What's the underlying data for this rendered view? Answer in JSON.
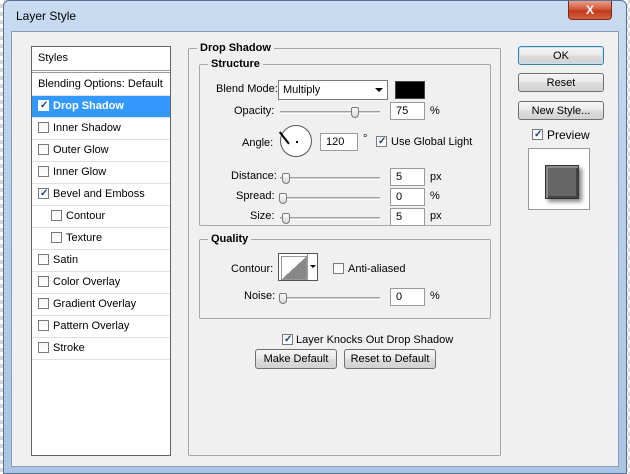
{
  "window": {
    "title": "Layer Style",
    "close_glyph": "X"
  },
  "left_panel": {
    "header": "Styles",
    "blending_options": "Blending Options: Default",
    "items": [
      {
        "label": "Drop Shadow",
        "checked": true,
        "selected": true
      },
      {
        "label": "Inner Shadow",
        "checked": false
      },
      {
        "label": "Outer Glow",
        "checked": false
      },
      {
        "label": "Inner Glow",
        "checked": false
      },
      {
        "label": "Bevel and Emboss",
        "checked": true
      },
      {
        "label": "Contour",
        "checked": false,
        "sub": true
      },
      {
        "label": "Texture",
        "checked": false,
        "sub": true
      },
      {
        "label": "Satin",
        "checked": false
      },
      {
        "label": "Color Overlay",
        "checked": false
      },
      {
        "label": "Gradient Overlay",
        "checked": false
      },
      {
        "label": "Pattern Overlay",
        "checked": false
      },
      {
        "label": "Stroke",
        "checked": false
      }
    ]
  },
  "drop_shadow": {
    "title": "Drop Shadow",
    "structure": {
      "title": "Structure",
      "blend_mode_label": "Blend Mode:",
      "blend_mode_value": "Multiply",
      "shadow_color": "#000000",
      "opacity_label": "Opacity:",
      "opacity_value": "75",
      "opacity_unit": "%",
      "angle_label": "Angle:",
      "angle_value": "120",
      "angle_unit": "°",
      "use_global_light": "Use Global Light",
      "use_global_light_checked": true,
      "distance_label": "Distance:",
      "distance_value": "5",
      "distance_unit": "px",
      "spread_label": "Spread:",
      "spread_value": "0",
      "spread_unit": "%",
      "size_label": "Size:",
      "size_value": "5",
      "size_unit": "px"
    },
    "quality": {
      "title": "Quality",
      "contour_label": "Contour:",
      "anti_aliased": "Anti-aliased",
      "anti_aliased_checked": false,
      "noise_label": "Noise:",
      "noise_value": "0",
      "noise_unit": "%"
    },
    "knocks_out": "Layer Knocks Out Drop Shadow",
    "knocks_out_checked": true,
    "make_default": "Make Default",
    "reset_to_default": "Reset to Default"
  },
  "right_panel": {
    "ok": "OK",
    "reset": "Reset",
    "new_style": "New Style...",
    "preview": "Preview",
    "preview_checked": true
  }
}
